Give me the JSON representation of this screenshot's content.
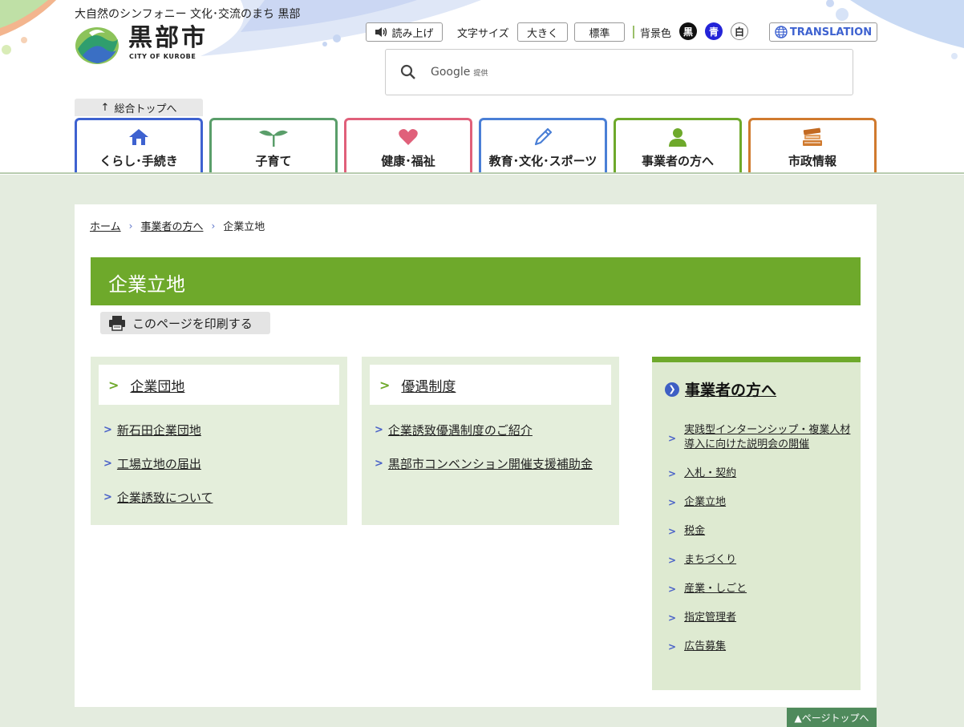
{
  "header": {
    "catchphrase": "大自然のシンフォニー 文化･交流のまち 黒部",
    "logo_name": "黒部市",
    "logo_sub": "CITY OF KUROBE",
    "read_aloud": "読み上げ",
    "font_size_label": "文字サイズ",
    "font_large": "大きく",
    "font_standard": "標準",
    "bg_color_label": "背景色",
    "bg_black": "黒",
    "bg_blue": "青",
    "bg_white": "白",
    "translation": "TRANSLATION",
    "search_brand": "Google",
    "search_provided": "提供",
    "top_link": "総合トップへ"
  },
  "gnav": [
    {
      "label": "くらし･手続き",
      "icon": "house-icon",
      "color": "#3e62d0"
    },
    {
      "label": "子育て",
      "icon": "sprout-icon",
      "color": "#5a9e6a"
    },
    {
      "label": "健康･福祉",
      "icon": "heart-icon",
      "color": "#e0607a"
    },
    {
      "label": "教育･文化･スポーツ",
      "icon": "pencil-icon",
      "color": "#4a7fd6"
    },
    {
      "label": "事業者の方へ",
      "icon": "person-icon",
      "color": "#6ea92b"
    },
    {
      "label": "市政情報",
      "icon": "books-icon",
      "color": "#d07a2e"
    }
  ],
  "breadcrumb": {
    "home": "ホーム",
    "parent": "事業者の方へ",
    "current": "企業立地"
  },
  "page": {
    "title": "企業立地",
    "print": "このページを印刷する"
  },
  "boxes": [
    {
      "heading": "企業団地",
      "items": [
        "新石田企業団地",
        "工場立地の届出",
        "企業誘致について"
      ]
    },
    {
      "heading": "優遇制度",
      "items": [
        "企業誘致優遇制度のご紹介",
        "黒部市コンベンション開催支援補助金"
      ]
    }
  ],
  "side": {
    "heading": "事業者の方へ",
    "items": [
      "実践型インターンシップ・複業人材導入に向けた説明会の開催",
      "入札・契約",
      "企業立地",
      "税金",
      "まちづくり",
      "産業・しごと",
      "指定管理者",
      "広告募集"
    ]
  },
  "pagetop": "▲ページトップへ",
  "colors": {
    "accent_green": "#6ea92b",
    "page_bg": "#e4ecdf",
    "link_chevron": "#4a62c8"
  }
}
